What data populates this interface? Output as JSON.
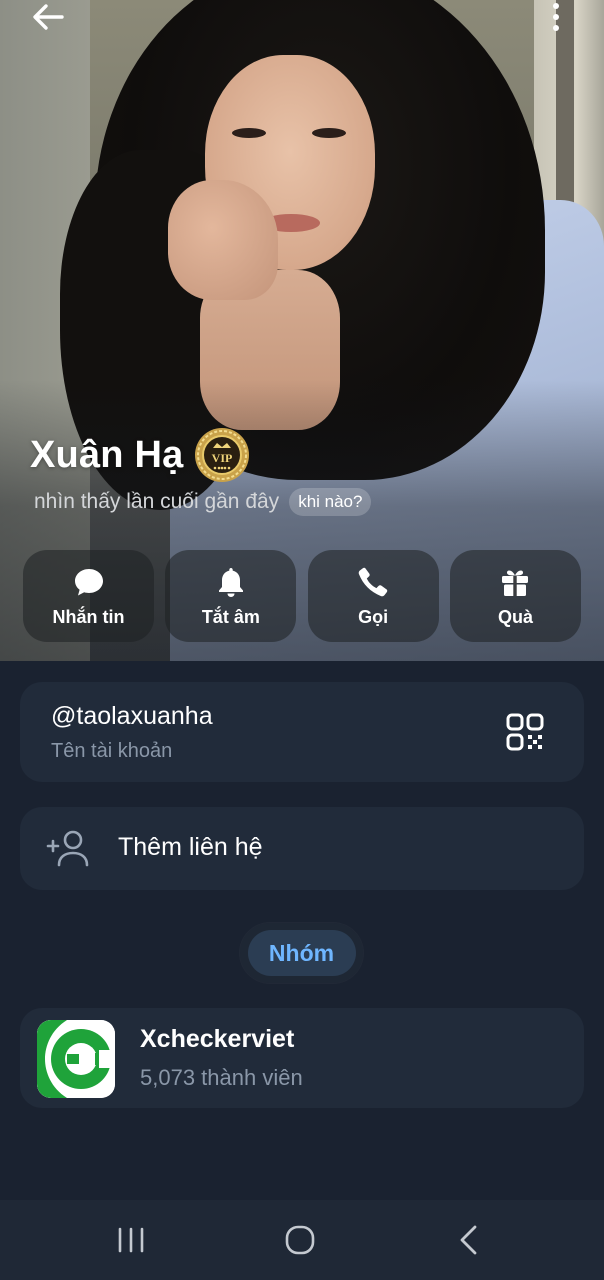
{
  "header": {
    "back_icon": "arrow-left-icon",
    "more_icon": "more-vertical-icon"
  },
  "profile": {
    "name": "Xuân Hạ",
    "badge": {
      "icon": "vip-badge-icon",
      "text": "VIP",
      "color": "#c9a24a"
    },
    "last_seen": "nhìn thấy lần cuối gần đây",
    "last_seen_pill": "khi nào?"
  },
  "actions": [
    {
      "label": "Nhắn tin",
      "icon": "message-icon"
    },
    {
      "label": "Tắt âm",
      "icon": "bell-icon"
    },
    {
      "label": "Gọi",
      "icon": "phone-icon"
    },
    {
      "label": "Quà",
      "icon": "gift-icon"
    }
  ],
  "username_card": {
    "value": "@taolaxuanha",
    "caption": "Tên tài khoản",
    "qr_icon": "qr-code-icon"
  },
  "contact_card": {
    "label": "Thêm liên hệ",
    "icon": "add-contact-icon"
  },
  "tabs": {
    "active": "Nhóm"
  },
  "group": {
    "name": "Xcheckerviet",
    "members": "5,073 thành viên",
    "logo_color": "#1fa33a"
  },
  "system_nav": {
    "recents_icon": "recents-icon",
    "home_icon": "home-icon",
    "back_icon": "back-chevron-icon"
  },
  "colors": {
    "background": "#1a2230",
    "card": "#212b3a",
    "accent": "#6fb6ff",
    "secondary_text": "#8a97a8"
  }
}
